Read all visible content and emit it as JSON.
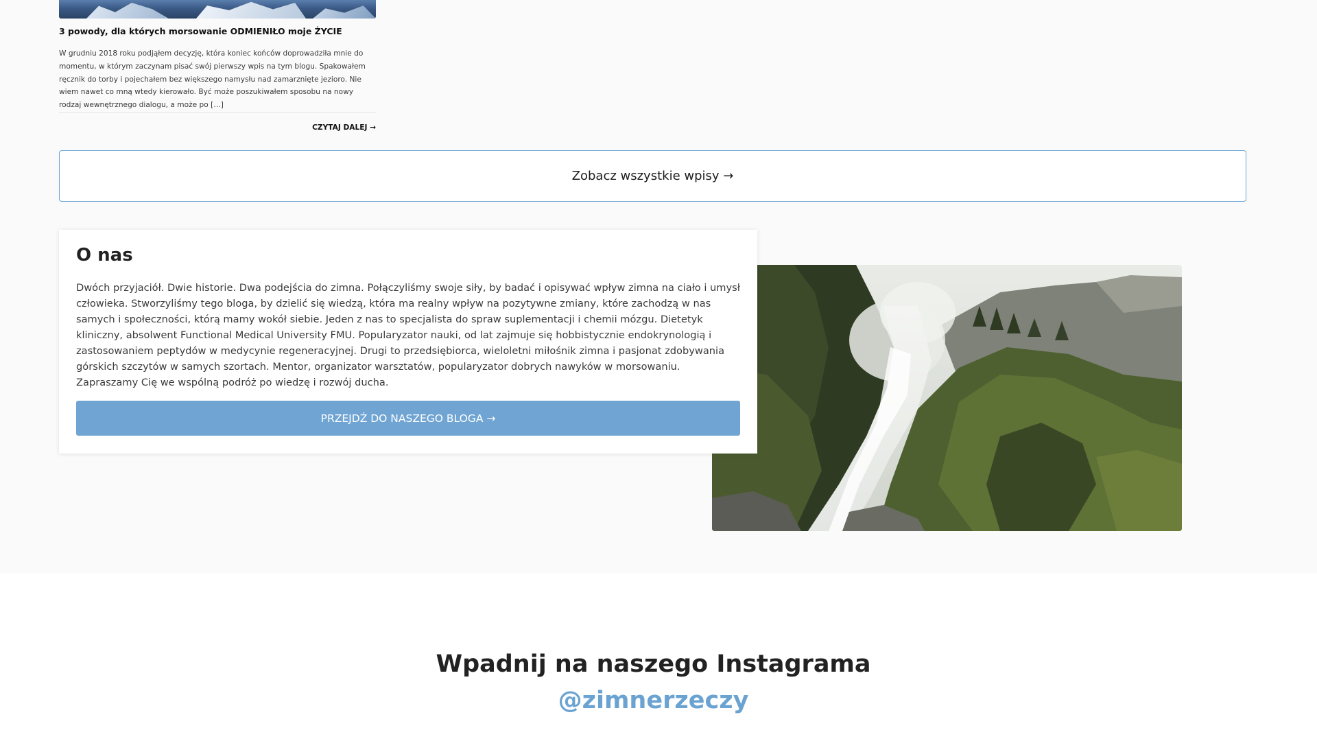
{
  "post": {
    "title": "3 powody, dla których morsowanie ODMIENIŁO moje ŻYCIE",
    "excerpt": "  W grudniu 2018 roku podjąłem decyzję, która koniec końców doprowadziła mnie do momentu, w którym zaczynam pisać swój pierwszy wpis na tym blogu. Spakowałem ręcznik do torby i pojechałem bez większego namysłu nad zamarznięte jezioro. Nie wiem nawet co mną wtedy kierowało. Być może poszukiwałem sposobu na nowy rodzaj wewnętrznego dialogu, a może po […]",
    "read_more": "CZYTAJ DALEJ →"
  },
  "see_all": {
    "label": "Zobacz wszystkie wpisy →"
  },
  "about": {
    "title": "O nas",
    "text": "Dwóch przyjaciół. Dwie historie. Dwa podejścia do zimna. Połączyliśmy swoje siły, by badać i opisywać wpływ zimna na ciało i umysł człowieka. Stworzyliśmy tego bloga, by dzielić się wiedzą, która ma realny wpływ na pozytywne zmiany, które zachodzą w nas samych i społeczności, którą mamy wokół siebie. Jeden z nas to specjalista do spraw suplementacji i chemii mózgu. Dietetyk kliniczny, absolwent Functional Medical University FMU. Popularyzator nauki, od lat zajmuje się hobbistycznie endokrynologią i zastosowaniem peptydów w medycynie regeneracyjnej. Drugi to przedsiębiorca, wieloletni miłośnik zimna i pasjonat zdobywania górskich szczytów w samych szortach. Mentor, organizator warsztatów, popularyzator dobrych nawyków w morsowaniu. Zapraszamy Cię we wspólną podróż po wiedzę i rozwój ducha.",
    "button_label": "PRZEJDŹ DO NASZEGO BLOGA →"
  },
  "instagram": {
    "title": "Wpadnij na naszego Instagrama",
    "handle": "@zimnerzeczy"
  },
  "colors": {
    "accent": "#6fa4d3",
    "handle": "#6aa3d1",
    "section_bg": "#fafafa"
  }
}
